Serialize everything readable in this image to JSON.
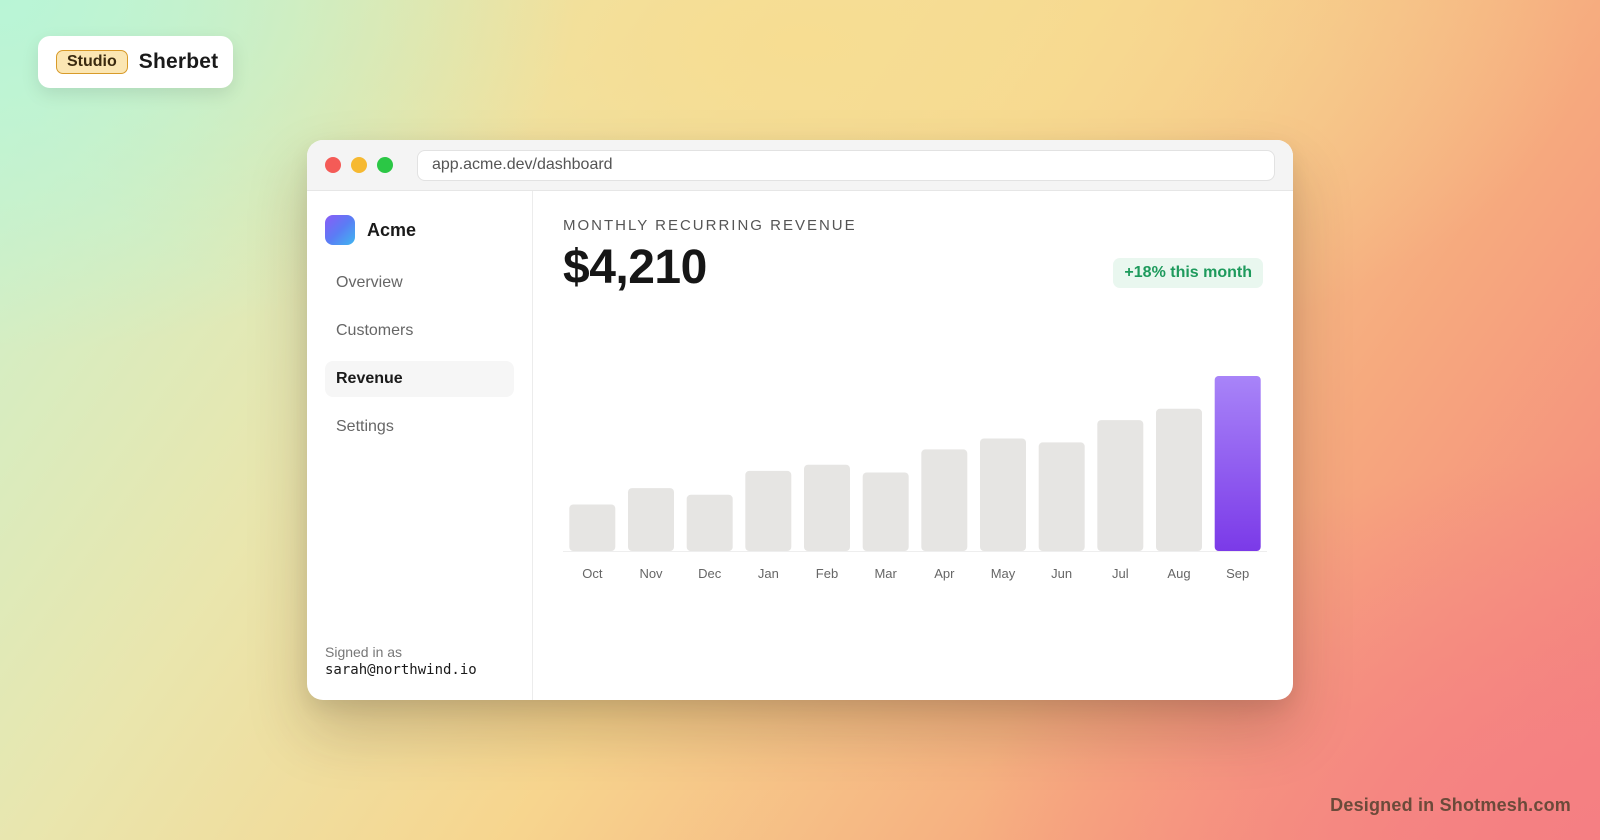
{
  "studio_badge": {
    "tag": "Studio",
    "name": "Sherbet"
  },
  "window": {
    "url": "app.acme.dev/dashboard",
    "brand": "Acme",
    "nav": [
      {
        "label": "Overview",
        "active": false
      },
      {
        "label": "Customers",
        "active": false
      },
      {
        "label": "Revenue",
        "active": true
      },
      {
        "label": "Settings",
        "active": false
      }
    ],
    "signed_in": {
      "label": "Signed in as",
      "email": "sarah@northwind.io"
    },
    "kpi": {
      "label": "MONTHLY RECURRING REVENUE",
      "value": "$4,210",
      "change": "+18% this month"
    }
  },
  "chart_data": {
    "type": "bar",
    "categories": [
      "Oct",
      "Nov",
      "Dec",
      "Jan",
      "Feb",
      "Mar",
      "Apr",
      "May",
      "Jun",
      "Jul",
      "Aug",
      "Sep"
    ],
    "values": [
      1190,
      1610,
      1440,
      2050,
      2210,
      2010,
      2600,
      2880,
      2780,
      3350,
      3640,
      4480
    ],
    "highlight_index": 11,
    "bar_color": "#e6e5e3",
    "highlight_gradient": [
      "#a884f8",
      "#7b3ae8"
    ]
  },
  "footer": {
    "credit": "Designed in Shotmesh.com"
  }
}
